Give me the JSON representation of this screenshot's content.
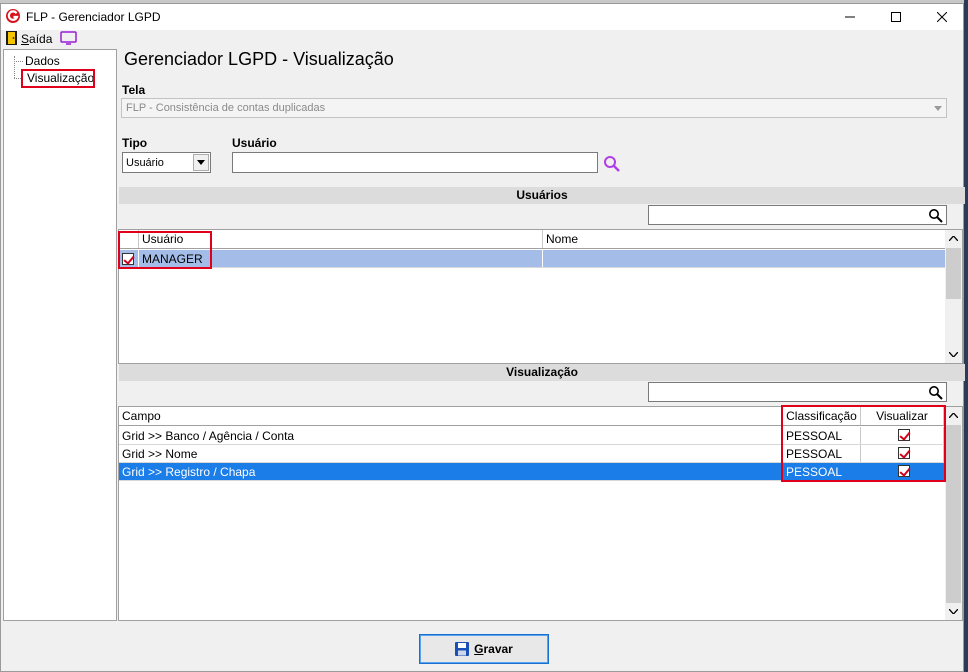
{
  "window": {
    "title": "FLP - Gerenciador LGPD"
  },
  "toolbar": {
    "exit_label": "Saída",
    "exit_icon": "exit-door-icon",
    "monitor_icon": "monitor-icon"
  },
  "tree": {
    "items": [
      {
        "label": "Dados"
      },
      {
        "label": "Visualização",
        "selected": true
      }
    ]
  },
  "main": {
    "title": "Gerenciador LGPD - Visualização",
    "tela_label": "Tela",
    "tela_value": "FLP - Consistência de contas duplicadas",
    "tipo_label": "Tipo",
    "tipo_value": "Usuário",
    "usuario_label": "Usuário",
    "usuario_value": ""
  },
  "usuarios_section": {
    "title": "Usuários",
    "columns": [
      "Usuário",
      "Nome"
    ],
    "rows": [
      {
        "checked": true,
        "usuario": "MANAGER",
        "nome": ""
      }
    ]
  },
  "visualizacao_section": {
    "title": "Visualização",
    "columns": [
      "Campo",
      "Classificação",
      "Visualizar"
    ],
    "rows": [
      {
        "campo": "Grid >> Banco / Agência / Conta",
        "classificacao": "PESSOAL",
        "visualizar": true
      },
      {
        "campo": "Grid >> Nome",
        "classificacao": "PESSOAL",
        "visualizar": true
      },
      {
        "campo": "Grid >> Registro / Chapa",
        "classificacao": "PESSOAL",
        "visualizar": true
      }
    ]
  },
  "footer": {
    "save_label": "Gravar"
  },
  "colors": {
    "highlight_box": "#e0001b",
    "selected_row": "#1a7de8",
    "selected_row_light": "#a4bde8"
  }
}
